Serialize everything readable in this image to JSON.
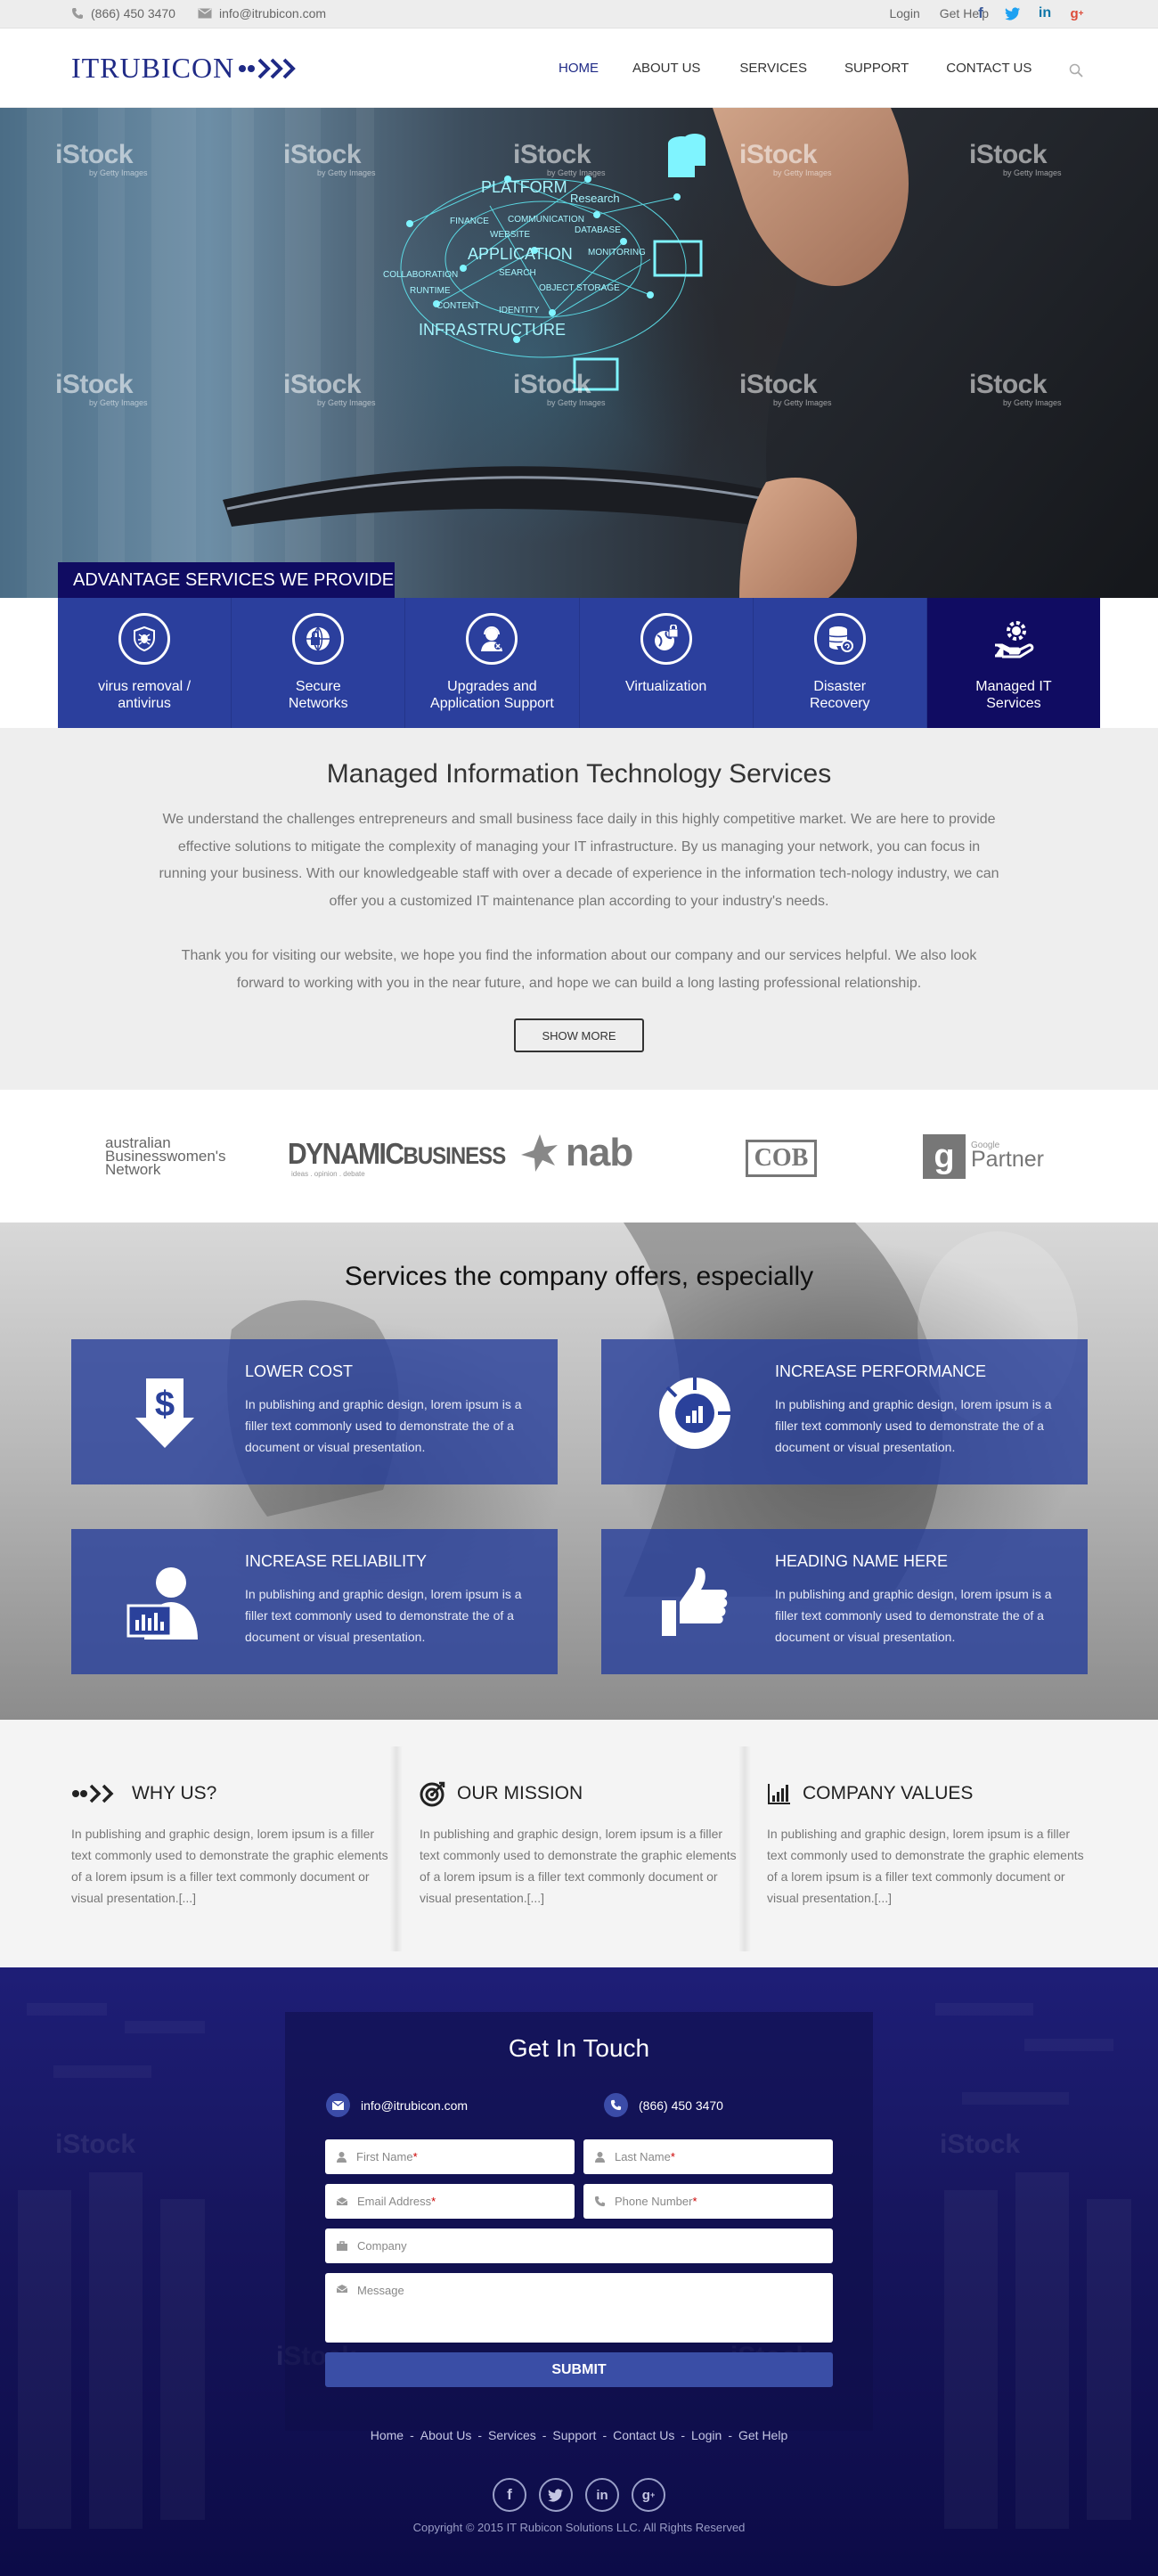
{
  "topbar": {
    "phone": "(866) 450 3470",
    "email": "info@itrubicon.com",
    "login": "Login",
    "get_help": "Get Help",
    "social": [
      "facebook-icon",
      "twitter-icon",
      "linkedin-icon",
      "google-plus-icon"
    ]
  },
  "header": {
    "logo": "ITRUBICON",
    "nav": [
      "HOME",
      "ABOUT US",
      "SERVICES",
      "SUPPORT",
      "CONTACT US"
    ],
    "active_nav": "HOME"
  },
  "hero": {
    "watermark": "iStock",
    "watermark_sub": "by Getty Images",
    "network_words": [
      "PLATFORM",
      "Research",
      "FINANCE",
      "COMMUNICATION",
      "DATABASE",
      "WEBSITE",
      "APPLICATION",
      "MONITORING",
      "COLLABORATION",
      "SEARCH",
      "OBJECT STORAGE",
      "RUNTIME",
      "CONTENT",
      "IDENTITY",
      "INFRASTRUCTURE"
    ]
  },
  "advantage": {
    "title": "ADVANTAGE SERVICES WE PROVIDE",
    "tabs": [
      {
        "label": "virus removal / antivirus",
        "icon": "shield-bug-icon"
      },
      {
        "label": "Secure Networks",
        "icon": "lock-globe-icon"
      },
      {
        "label": "Upgrades and Application Support",
        "icon": "support-agent-icon"
      },
      {
        "label": "Virtualization",
        "icon": "globe-lock-icon"
      },
      {
        "label": "Disaster Recovery",
        "icon": "database-recovery-icon"
      },
      {
        "label": "Managed IT Services",
        "icon": "hand-gear-icon"
      }
    ],
    "active_tab": "Managed IT Services"
  },
  "intro": {
    "title": "Managed Information Technology Services",
    "para1": "We understand the challenges entrepreneurs and small business face daily in this highly competitive market. We are here to provide effective solutions to mitigate the complexity of managing your IT infrastructure. By us managing your network, you can focus in running your business. With our knowledgeable staff with over a decade of experience in the information tech-nology industry, we can offer you a customized IT maintenance plan according to your industry's needs.",
    "para2": "Thank you for visiting our website, we hope you find the information about our company and our services helpful. We also look forward to working with you in the near future, and hope we can build a long lasting professional relationship.",
    "button": "SHOW MORE"
  },
  "partners": {
    "abn_1": "australian",
    "abn_2": "Businesswomen's",
    "abn_3": "Network",
    "dynamic": "DYNAMIC",
    "business": "BUSINESS",
    "dynamic_sub": "ideas . opinion . debate",
    "nab": "nab",
    "cob": "COB",
    "google": "Google",
    "partner": "Partner"
  },
  "services": {
    "title": "Services the company offers, especially",
    "items": [
      {
        "title": "LOWER COST",
        "text": "In publishing and graphic design, lorem ipsum is a filler text commonly used to demonstrate the of a document or visual presentation.",
        "icon": "dollar-down-icon"
      },
      {
        "title": "INCREASE PERFORMANCE",
        "text": "In publishing and graphic design, lorem ipsum is a filler text commonly used to demonstrate the of a document or visual presentation.",
        "icon": "performance-chart-icon"
      },
      {
        "title": "INCREASE RELIABILITY",
        "text": "In publishing and graphic design, lorem ipsum is a filler text commonly used to demonstrate the of a document or visual presentation.",
        "icon": "user-monitor-icon"
      },
      {
        "title": "HEADING NAME HERE",
        "text": "In publishing and graphic design, lorem ipsum is a filler text commonly used to demonstrate the of a document or visual presentation.",
        "icon": "thumbs-up-icon"
      }
    ]
  },
  "why": [
    {
      "title": "WHY US?",
      "text": "In publishing and graphic design, lorem ipsum is a filler text commonly used to demonstrate the graphic elements of a lorem ipsum is a filler text commonly document or visual presentation.[...]",
      "icon": "arrows-icon"
    },
    {
      "title": "OUR MISSION",
      "text": "In publishing and graphic design, lorem ipsum is a filler text commonly used to demonstrate the graphic elements of a lorem ipsum is a filler text commonly document or visual presentation.[...]",
      "icon": "target-icon"
    },
    {
      "title": "COMPANY VALUES",
      "text": "In publishing and graphic design, lorem ipsum is a filler text commonly used to demonstrate the graphic elements of a lorem ipsum is a filler text commonly document or visual presentation.[...]",
      "icon": "bar-chart-icon"
    }
  ],
  "contact": {
    "title": "Get In Touch",
    "email": "info@itrubicon.com",
    "phone": "(866) 450 3470",
    "first_name": "First Name",
    "last_name": "Last Name",
    "email_address": "Email Address",
    "phone_number": "Phone Number",
    "company": "Company",
    "message": "Message",
    "required_mark": "*",
    "submit": "SUBMIT"
  },
  "footer": {
    "links": [
      "Home",
      "About Us",
      "Services",
      "Support",
      "Contact Us",
      "Login",
      "Get Help"
    ],
    "separator": "-",
    "copyright": "Copyright © 2015 IT Rubicon Solutions LLC. All Rights Reserved"
  },
  "colors": {
    "brand_navy": "#100c62",
    "tab_blue": "#2b3f9d",
    "card_blue": "#2a419b",
    "footer_navy": "#17165e",
    "submit_blue": "#3a4ea6"
  }
}
